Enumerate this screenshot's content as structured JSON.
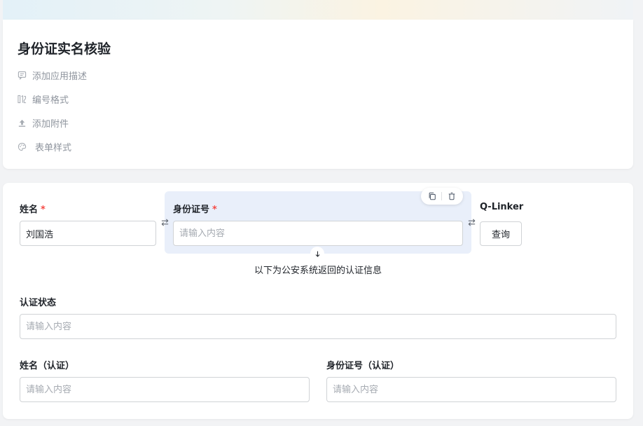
{
  "form": {
    "title": "身份证实名核验",
    "meta": {
      "add_description": "添加应用描述",
      "numbering_format": "编号格式",
      "add_attachment": "添加附件",
      "form_style": "表单样式"
    }
  },
  "fields": {
    "name": {
      "label": "姓名",
      "required_mark": "*",
      "value": "刘国浩"
    },
    "id_number": {
      "label": "身份证号",
      "required_mark": "*",
      "placeholder": "请输入内容"
    },
    "linker": {
      "label": "Q-Linker",
      "button": "查询"
    },
    "result_note": "以下为公安系统返回的认证信息",
    "auth_status": {
      "label": "认证状态",
      "placeholder": "请输入内容"
    },
    "auth_name": {
      "label": "姓名（认证）",
      "placeholder": "请输入内容"
    },
    "auth_id": {
      "label": "身份证号（认证）",
      "placeholder": "请输入内容"
    }
  },
  "icons": {
    "description": "comment-icon",
    "numbering": "numbering-icon",
    "attachment": "upload-icon",
    "style": "palette-icon",
    "copy": "copy-icon",
    "delete": "trash-icon",
    "swap": "swap-icon",
    "arrow": "arrow-down-icon"
  },
  "colors": {
    "required": "#f54a45",
    "highlight": "#e9effa",
    "muted_text": "#8f959e"
  }
}
